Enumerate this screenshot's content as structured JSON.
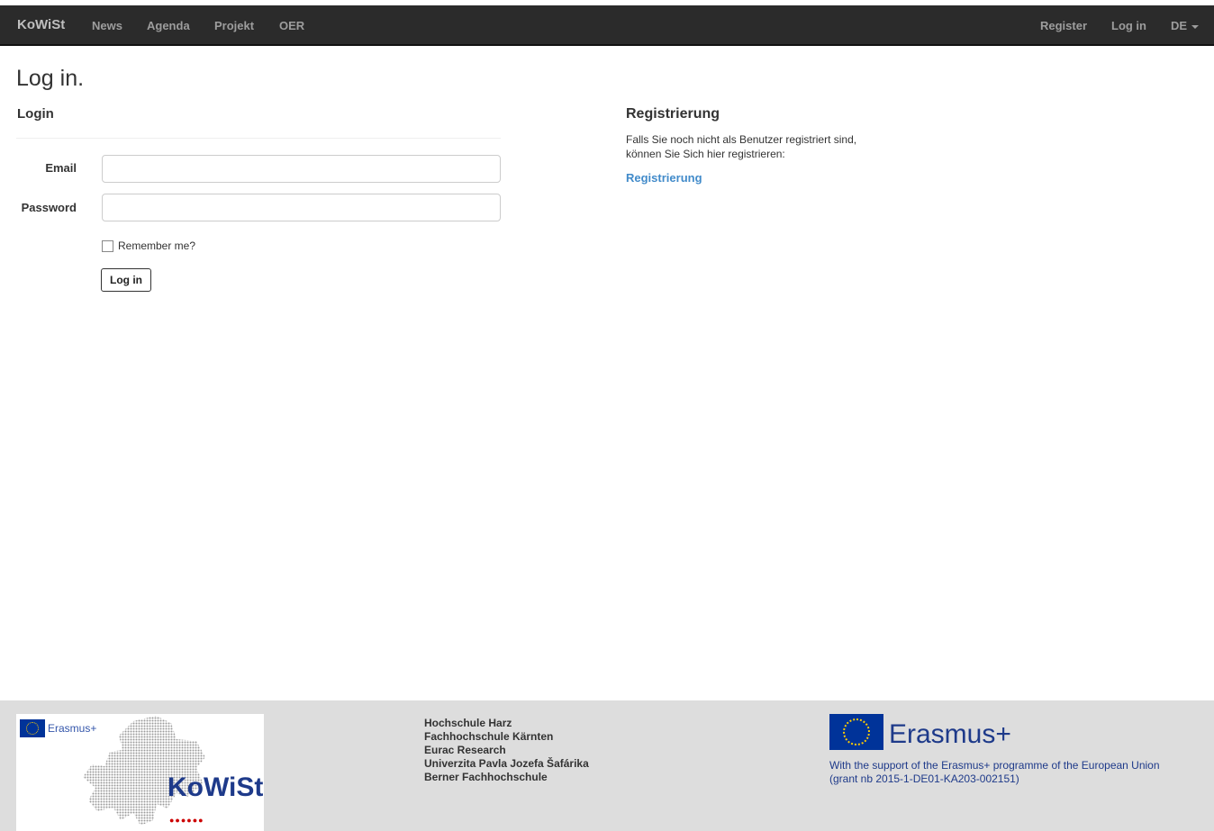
{
  "navbar": {
    "brand": "KoWiSt",
    "left_links": [
      "News",
      "Agenda",
      "Projekt",
      "OER"
    ],
    "right_links": [
      "Register",
      "Log in"
    ],
    "language": "DE",
    "bg_color": "#2b2b2b"
  },
  "page": {
    "title": "Log in.",
    "section_title": "Login"
  },
  "form": {
    "email_label": "Email",
    "email_value": "",
    "password_label": "Password",
    "password_value": "",
    "remember_label": "Remember me?",
    "submit_label": "Log in"
  },
  "register": {
    "title": "Registrierung",
    "text_line1": "Falls Sie noch nicht als Benutzer registriert sind,",
    "text_line2": "können Sie Sich hier registrieren:",
    "link": "Registrierung",
    "link_color": "#428bca"
  },
  "footer": {
    "logo_erasmus": "Erasmus+",
    "logo_kowist": "KoWiSt",
    "partners": [
      "Hochschule Harz",
      "Fachhochschule Kärnten",
      "Eurac Research",
      "Univerzita Pavla Jozefa Šafárika",
      "Berner Fachhochschule"
    ],
    "erasmus": "Erasmus+",
    "support_line1": "With the support of the Erasmus+ programme of the European Union",
    "support_line2": "(grant nb 2015-1-DE01-KA203-002151)",
    "bg_color": "#dddddd"
  }
}
